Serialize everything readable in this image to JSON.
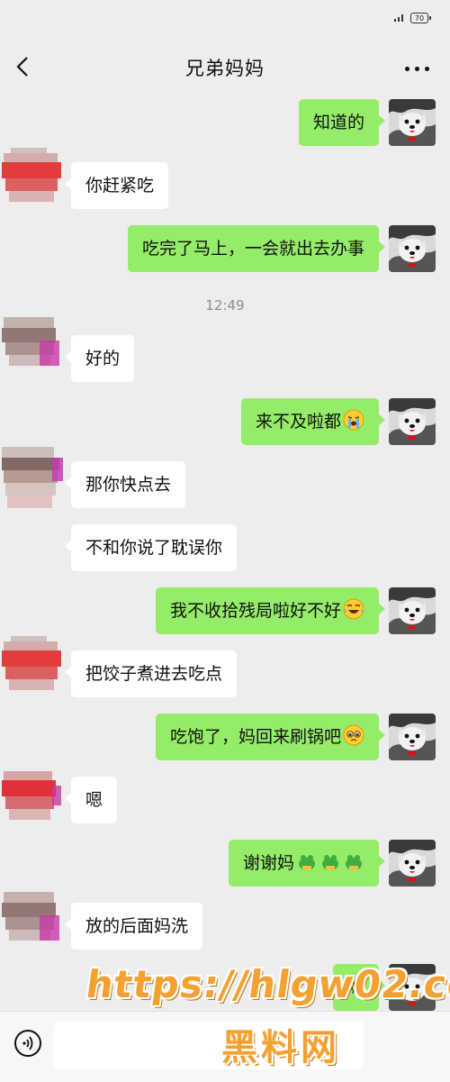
{
  "status": {
    "battery": "70"
  },
  "header": {
    "title": "兄弟妈妈"
  },
  "messages": [
    {
      "side": "out",
      "text": "知道的"
    },
    {
      "side": "in",
      "text": "你赶紧吃"
    },
    {
      "side": "out",
      "text": "吃完了马上，一会就出去办事"
    },
    {
      "side": "in",
      "text": "好的"
    },
    {
      "side": "out",
      "text": "来不及啦都",
      "emoji": "crying-face-emoji"
    },
    {
      "side": "in",
      "text": "那你快点去"
    },
    {
      "side": "in",
      "text": "不和你说了耽误你"
    },
    {
      "side": "out",
      "text": "我不收拾残局啦好不好",
      "emoji": "laughing-crying-emoji"
    },
    {
      "side": "in",
      "text": "把饺子煮进去吃点"
    },
    {
      "side": "out",
      "text": "吃饱了，妈回来刷锅吧",
      "emoji": "pleading-face-emoji"
    },
    {
      "side": "in",
      "text": "嗯"
    },
    {
      "side": "out",
      "text": "谢谢妈",
      "emoji": "bowing-frog-emoji"
    },
    {
      "side": "in",
      "text": "放的后面妈洗"
    },
    {
      "side": "out",
      "text": "嗯"
    }
  ],
  "timestamp": "12:49",
  "watermark": {
    "line1": "https://hlgw02.com",
    "line2": "黑料网"
  },
  "colors": {
    "background": "#ededed",
    "outgoing": "#95ec69",
    "incoming": "#ffffff",
    "watermark": "#f5a030"
  },
  "icons": {
    "back": "chevron-left-icon",
    "more": "more-dots-icon",
    "voice": "voice-icon"
  }
}
